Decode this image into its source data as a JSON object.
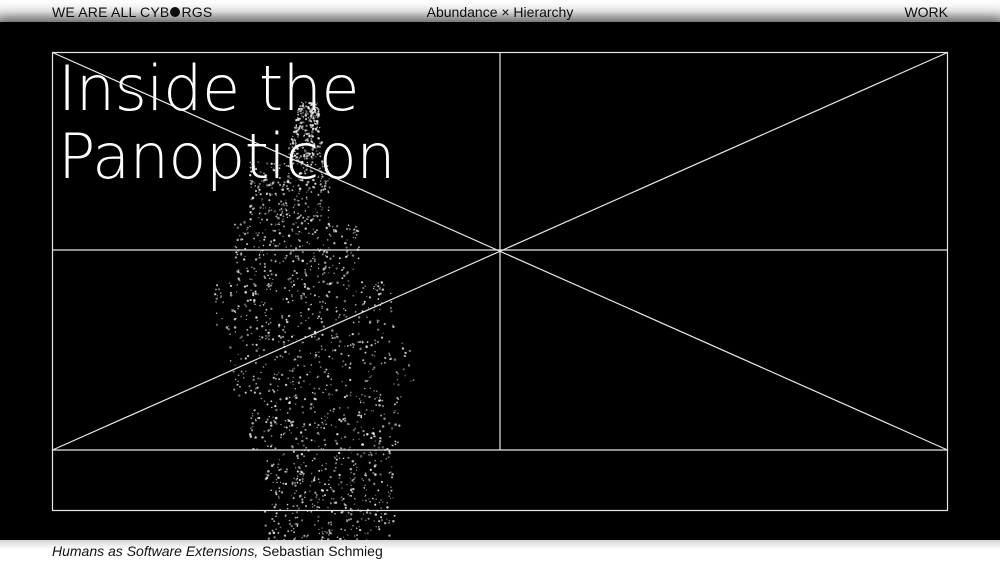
{
  "header": {
    "brand_prefix": "WE ARE ALL CYB",
    "brand_suffix": "RGS",
    "center_title": "Abundance × Hierarchy",
    "nav_work": "WORK"
  },
  "hero": {
    "title_line1": "Inside the",
    "title_line2": "Panopticon",
    "background_color": "#000000",
    "line_color": "#e6e6e6"
  },
  "caption": {
    "work_title": "Humans as Software Extensions,",
    "artist": "Sebastian Schmieg"
  }
}
